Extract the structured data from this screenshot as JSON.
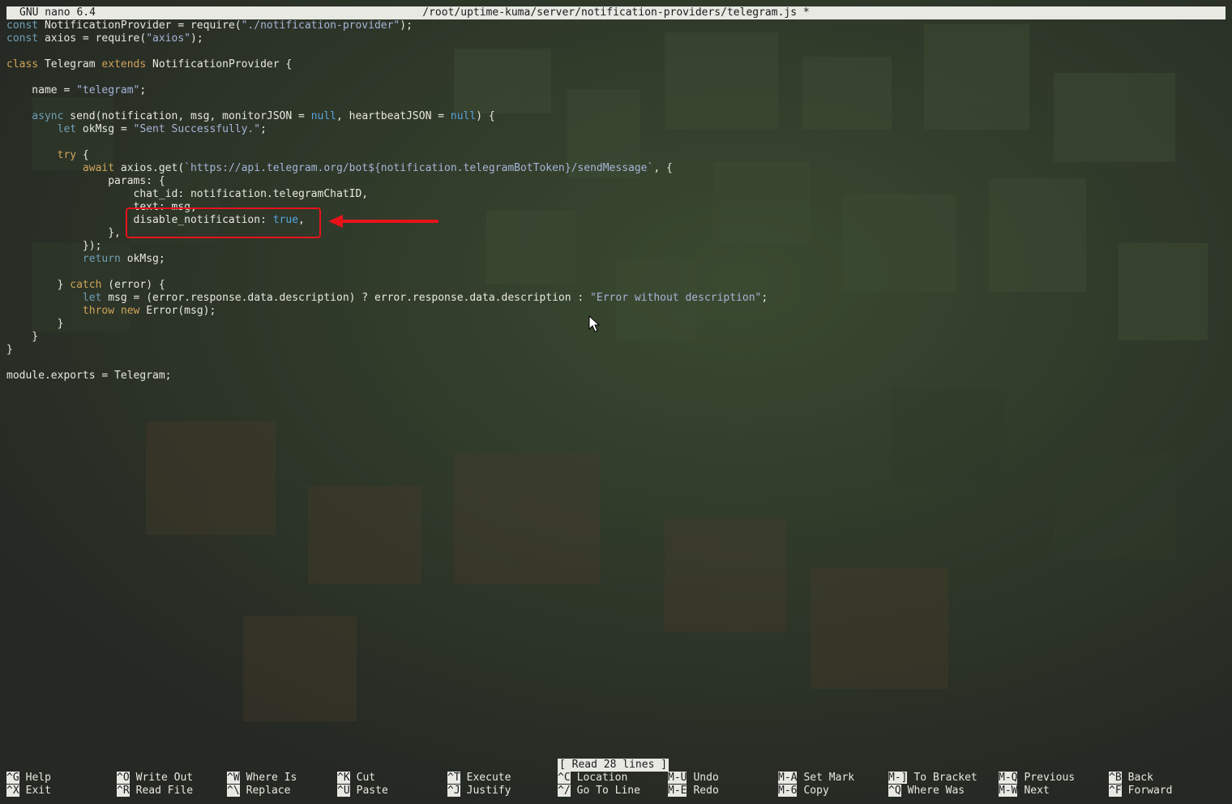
{
  "titlebar": {
    "app": "GNU nano 6.4",
    "path": "/root/uptime-kuma/server/notification-providers/telegram.js *"
  },
  "code_lines": [
    [
      [
        "decl",
        "const"
      ],
      [
        "plain",
        " NotificationProvider = require("
      ],
      [
        "str",
        "\"./notification-provider\""
      ],
      [
        "plain",
        ");"
      ]
    ],
    [
      [
        "decl",
        "const"
      ],
      [
        "plain",
        " axios = require("
      ],
      [
        "str",
        "\"axios\""
      ],
      [
        "plain",
        ");"
      ]
    ],
    [],
    [
      [
        "kw",
        "class"
      ],
      [
        "plain",
        " Telegram "
      ],
      [
        "kw",
        "extends"
      ],
      [
        "plain",
        " NotificationProvider {"
      ]
    ],
    [],
    [
      [
        "plain",
        "    name = "
      ],
      [
        "str",
        "\"telegram\""
      ],
      [
        "plain",
        ";"
      ]
    ],
    [],
    [
      [
        "decl",
        "    async"
      ],
      [
        "plain",
        " send(notification, msg, monitorJSON = "
      ],
      [
        "lit",
        "null"
      ],
      [
        "plain",
        ", heartbeatJSON = "
      ],
      [
        "lit",
        "null"
      ],
      [
        "plain",
        ") {"
      ]
    ],
    [
      [
        "decl",
        "        let"
      ],
      [
        "plain",
        " okMsg = "
      ],
      [
        "str",
        "\"Sent Successfully.\""
      ],
      [
        "plain",
        ";"
      ]
    ],
    [],
    [
      [
        "kw",
        "        try"
      ],
      [
        "plain",
        " {"
      ]
    ],
    [
      [
        "kw",
        "            await"
      ],
      [
        "plain",
        " axios.get("
      ],
      [
        "str",
        "`https://api.telegram.org/bot${notification.telegramBotToken}/sendMessage`"
      ],
      [
        "plain",
        ", {"
      ]
    ],
    [
      [
        "plain",
        "                params: {"
      ]
    ],
    [
      [
        "plain",
        "                    chat_id: notification.telegramChatID,"
      ]
    ],
    [
      [
        "plain",
        "                    text: msg,"
      ]
    ],
    [
      [
        "plain",
        "                    disable_notification: "
      ],
      [
        "lit",
        "true"
      ],
      [
        "plain",
        ","
      ]
    ],
    [
      [
        "plain",
        "                },"
      ]
    ],
    [
      [
        "plain",
        "            });"
      ]
    ],
    [
      [
        "decl",
        "            return"
      ],
      [
        "plain",
        " okMsg;"
      ]
    ],
    [],
    [
      [
        "plain",
        "        } "
      ],
      [
        "kw",
        "catch"
      ],
      [
        "plain",
        " (error) {"
      ]
    ],
    [
      [
        "decl",
        "            let"
      ],
      [
        "plain",
        " msg = (error.response.data.description) ? error.response.data.description : "
      ],
      [
        "str",
        "\"Error without description\""
      ],
      [
        "plain",
        ";"
      ]
    ],
    [
      [
        "kw",
        "            throw"
      ],
      [
        "plain",
        " "
      ],
      [
        "kw",
        "new"
      ],
      [
        "plain",
        " Error(msg);"
      ]
    ],
    [
      [
        "plain",
        "        }"
      ]
    ],
    [
      [
        "plain",
        "    }"
      ]
    ],
    [
      [
        "plain",
        "}"
      ]
    ],
    [],
    [
      [
        "plain",
        "module.exports = Telegram;"
      ]
    ]
  ],
  "status_message": "[ Read 28 lines ]",
  "shortcuts": [
    {
      "key": "^G",
      "label": "Help"
    },
    {
      "key": "^O",
      "label": "Write Out"
    },
    {
      "key": "^W",
      "label": "Where Is"
    },
    {
      "key": "^K",
      "label": "Cut"
    },
    {
      "key": "^T",
      "label": "Execute"
    },
    {
      "key": "^C",
      "label": "Location"
    },
    {
      "key": "M-U",
      "label": "Undo"
    },
    {
      "key": "M-A",
      "label": "Set Mark"
    },
    {
      "key": "M-]",
      "label": "To Bracket"
    },
    {
      "key": "M-Q",
      "label": "Previous"
    },
    {
      "key": "^B",
      "label": "Back"
    },
    {
      "key": "^X",
      "label": "Exit"
    },
    {
      "key": "^R",
      "label": "Read File"
    },
    {
      "key": "^\\",
      "label": "Replace"
    },
    {
      "key": "^U",
      "label": "Paste"
    },
    {
      "key": "^J",
      "label": "Justify"
    },
    {
      "key": "^/",
      "label": "Go To Line"
    },
    {
      "key": "M-E",
      "label": "Redo"
    },
    {
      "key": "M-6",
      "label": "Copy"
    },
    {
      "key": "^Q",
      "label": "Where Was"
    },
    {
      "key": "M-W",
      "label": "Next"
    },
    {
      "key": "^F",
      "label": "Forward"
    }
  ],
  "colors": {
    "background": "#2b2f28",
    "bar": "#e9e9e4",
    "highlight": "#e8131a",
    "keyword": "#d0a45a",
    "declaration": "#6e9fb8",
    "string": "#a6b4d8",
    "literal": "#58a6e0"
  },
  "annotation": {
    "icon": "red-arrow-icon",
    "target_line": 16
  },
  "mouse_cursor": {
    "icon": "mouse-pointer-icon"
  }
}
